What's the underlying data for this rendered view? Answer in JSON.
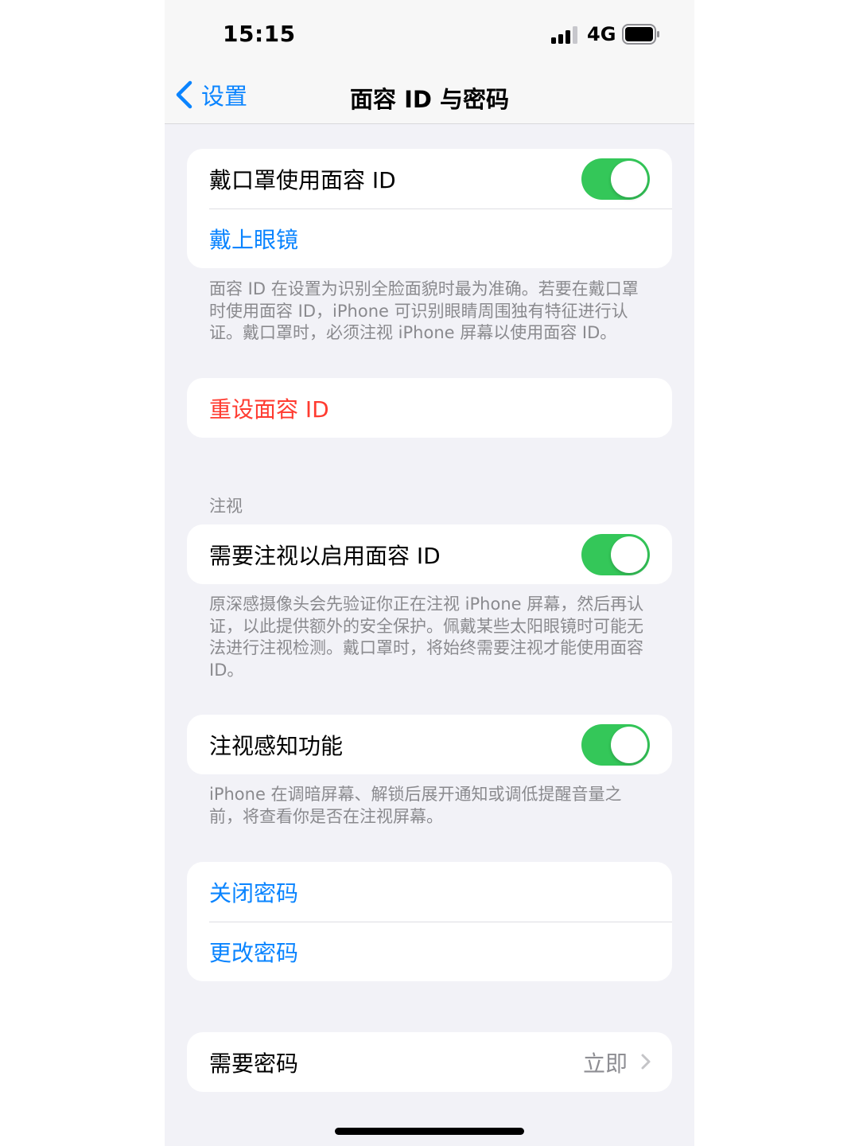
{
  "status_bar": {
    "time": "15:15",
    "network": "4G"
  },
  "nav": {
    "back_label": "设置",
    "title": "面容 ID 与密码"
  },
  "mask_group": {
    "mask_label": "戴口罩使用面容 ID",
    "mask_toggle_on": true,
    "glasses_label": "戴上眼镜"
  },
  "mask_footer": "面容 ID 在设置为识别全脸面貌时最为准确。若要在戴口罩时使用面容 ID，iPhone 可识别眼睛周围独有特征进行认证。戴口罩时，必须注视 iPhone 屏幕以使用面容 ID。",
  "reset": {
    "label": "重设面容 ID"
  },
  "attention": {
    "header": "注视",
    "require_label": "需要注视以启用面容 ID",
    "require_toggle_on": true,
    "footer": "原深感摄像头会先验证你正在注视 iPhone 屏幕，然后再认证，以此提供额外的安全保护。佩戴某些太阳眼镜时可能无法进行注视检测。戴口罩时，将始终需要注视才能使用面容 ID。"
  },
  "attention_aware": {
    "label": "注视感知功能",
    "toggle_on": true,
    "footer": "iPhone 在调暗屏幕、解锁后展开通知或调低提醒音量之前，将查看你是否在注视屏幕。"
  },
  "passcode": {
    "turn_off": "关闭密码",
    "change": "更改密码"
  },
  "require_passcode": {
    "label": "需要密码",
    "value": "立即"
  },
  "colors": {
    "accent": "#0a84ff",
    "toggle_on": "#34c759",
    "danger": "#ff3b30",
    "background": "#f2f2f7"
  },
  "icons": {
    "back": "chevron-left-icon",
    "disclosure": "chevron-right-icon",
    "signal": "signal-icon",
    "battery": "battery-icon"
  }
}
